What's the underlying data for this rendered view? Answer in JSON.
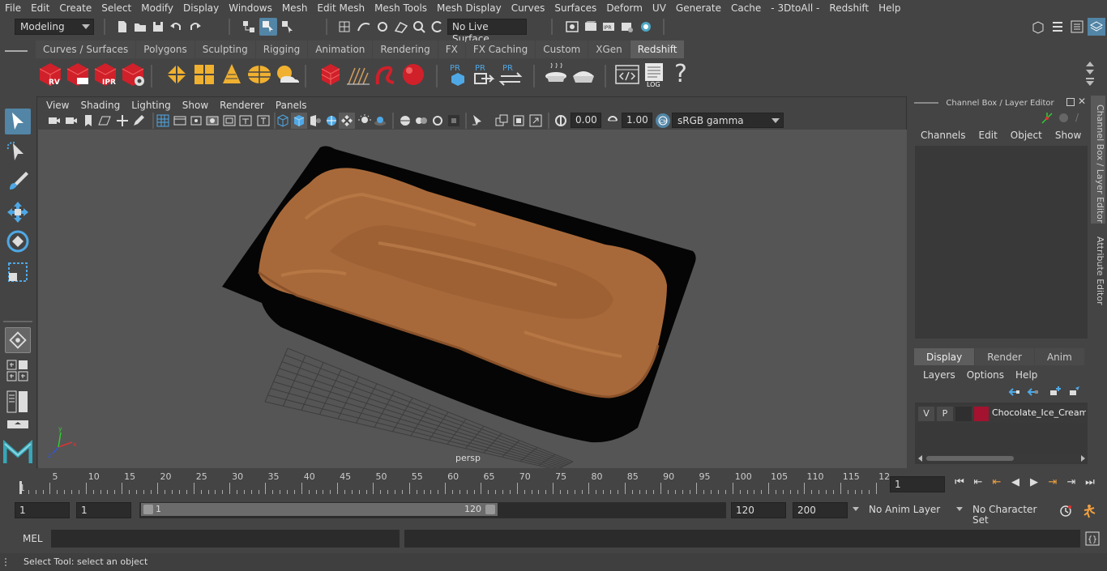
{
  "menubar": {
    "items": [
      "File",
      "Edit",
      "Create",
      "Select",
      "Modify",
      "Display",
      "Windows",
      "Mesh",
      "Edit Mesh",
      "Mesh Tools",
      "Mesh Display",
      "Curves",
      "Surfaces",
      "Deform",
      "UV",
      "Generate",
      "Cache",
      "- 3DtoAll -",
      "Redshift",
      "Help"
    ]
  },
  "statusline": {
    "mode": "Modeling",
    "live_surface": "No Live Surface"
  },
  "shelf": {
    "tabs": [
      "Curves / Surfaces",
      "Polygons",
      "Sculpting",
      "Rigging",
      "Animation",
      "Rendering",
      "FX",
      "FX Caching",
      "Custom",
      "XGen",
      "Redshift"
    ],
    "active_tab": "Redshift",
    "icon_labels": {
      "rv": "RV",
      "ipr": "IPR",
      "pr1": "PR",
      "pr2": "PR",
      "pr3": "PR",
      "log": "LOG"
    }
  },
  "viewport": {
    "menu": [
      "View",
      "Shading",
      "Lighting",
      "Show",
      "Renderer",
      "Panels"
    ],
    "exposure": "0.00",
    "gamma": "1.00",
    "color_space": "sRGB gamma",
    "camera_label": "persp"
  },
  "channel_box": {
    "title": "Channel Box / Layer Editor",
    "menu": [
      "Channels",
      "Edit",
      "Object",
      "Show"
    ],
    "layer_tabs": [
      "Display",
      "Render",
      "Anim"
    ],
    "active_layer_tab": "Display",
    "layer_menu": [
      "Layers",
      "Options",
      "Help"
    ],
    "layer": {
      "visible": "V",
      "playback": "P",
      "name": "Chocolate_Ice_Cream_",
      "color": "#a3122e"
    }
  },
  "side_tabs": {
    "channel": "Channel Box / Layer Editor",
    "attribute": "Attribute Editor"
  },
  "timeslider": {
    "tick_labels": [
      "5",
      "10",
      "15",
      "20",
      "25",
      "30",
      "35",
      "40",
      "45",
      "50",
      "55",
      "60",
      "65",
      "70",
      "75",
      "80",
      "85",
      "90",
      "95",
      "100",
      "105",
      "110",
      "115",
      "12"
    ],
    "start_marker": "1",
    "current_frame": "1"
  },
  "range": {
    "start": "1",
    "playback_start": "1",
    "slider_start": "1",
    "slider_end": "120",
    "playback_end": "120",
    "end": "200",
    "anim_layer": "No Anim Layer",
    "character_set": "No Character Set"
  },
  "cmdline": {
    "label": "MEL"
  },
  "helpline": {
    "text": "Select Tool: select an object"
  },
  "colors": {
    "accent": "#5285a6",
    "redshift_red": "#d0202a",
    "ice_cream": "#a8693a",
    "tub": "#050505"
  }
}
